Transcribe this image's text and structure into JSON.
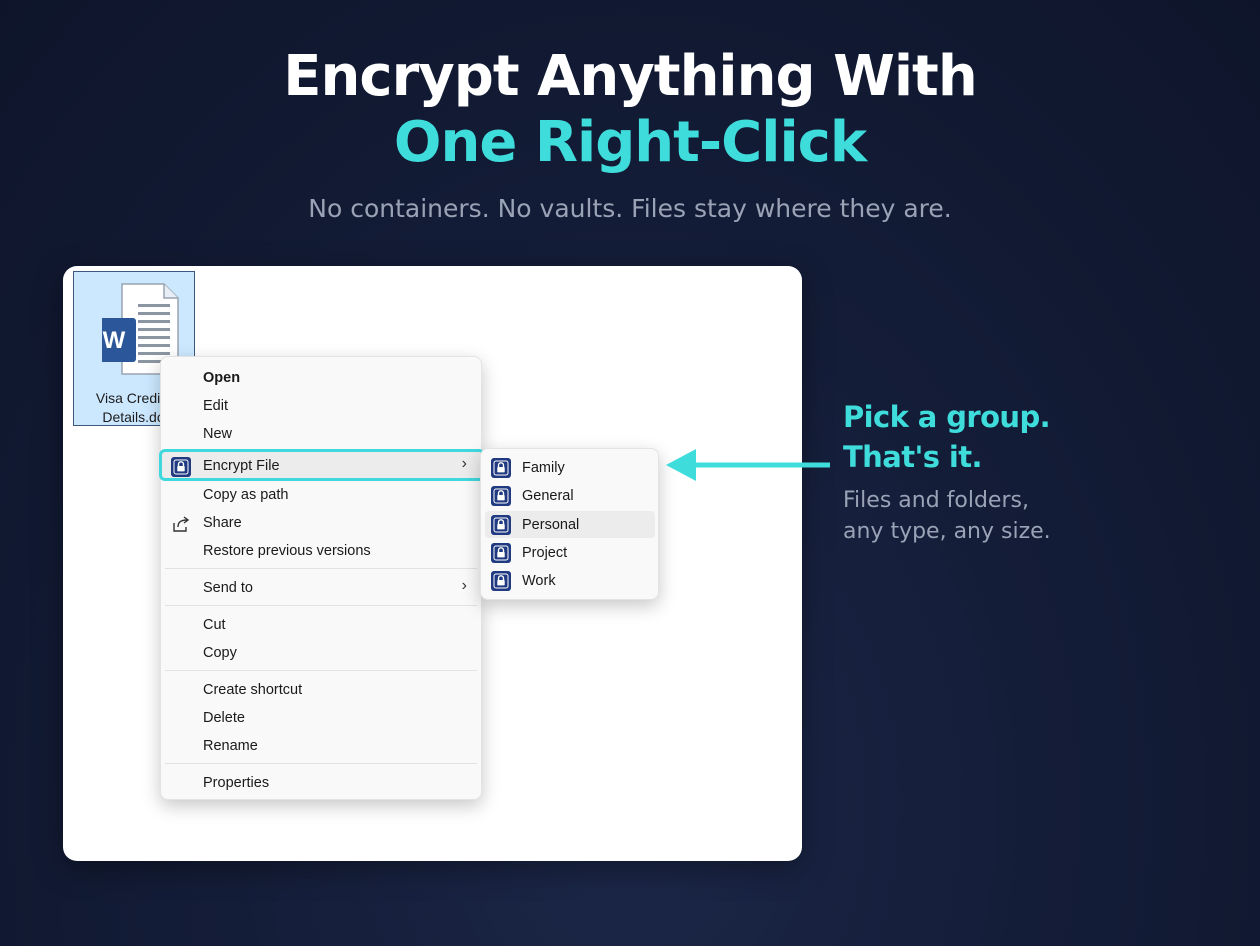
{
  "hero": {
    "title_line1": "Encrypt Anything With",
    "title_line2": "One Right-Click",
    "subtitle": "No containers. No vaults. Files stay where they are."
  },
  "file": {
    "name_line1": "Visa Credit C",
    "name_line2": "Details.doc",
    "icon": "word-document-icon"
  },
  "context_menu": {
    "items": [
      {
        "label": "Open",
        "bold": true
      },
      {
        "label": "Edit"
      },
      {
        "label": "New"
      },
      {
        "label": "Encrypt File",
        "icon": "lock-icon",
        "submenu": true,
        "highlighted": true
      },
      {
        "label": "Copy as path"
      },
      {
        "label": "Share",
        "icon": "share-icon"
      },
      {
        "label": "Restore previous versions"
      },
      {
        "label": "Send to",
        "submenu": true
      },
      {
        "label": "Cut"
      },
      {
        "label": "Copy"
      },
      {
        "label": "Create shortcut"
      },
      {
        "label": "Delete"
      },
      {
        "label": "Rename"
      },
      {
        "label": "Properties"
      }
    ]
  },
  "submenu": {
    "items": [
      {
        "label": "Family",
        "icon": "lock-icon"
      },
      {
        "label": "General",
        "icon": "lock-icon"
      },
      {
        "label": "Personal",
        "icon": "lock-icon",
        "hovered": true
      },
      {
        "label": "Project",
        "icon": "lock-icon"
      },
      {
        "label": "Work",
        "icon": "lock-icon"
      }
    ]
  },
  "callout": {
    "title_line1": "Pick a group.",
    "title_line2": "That's it.",
    "desc_line1": "Files and folders,",
    "desc_line2": "any type, any size."
  },
  "colors": {
    "accent": "#3fdcdc",
    "background": "#141d38",
    "lock_icon": "#1f3a80",
    "word_blue": "#2b579a"
  }
}
